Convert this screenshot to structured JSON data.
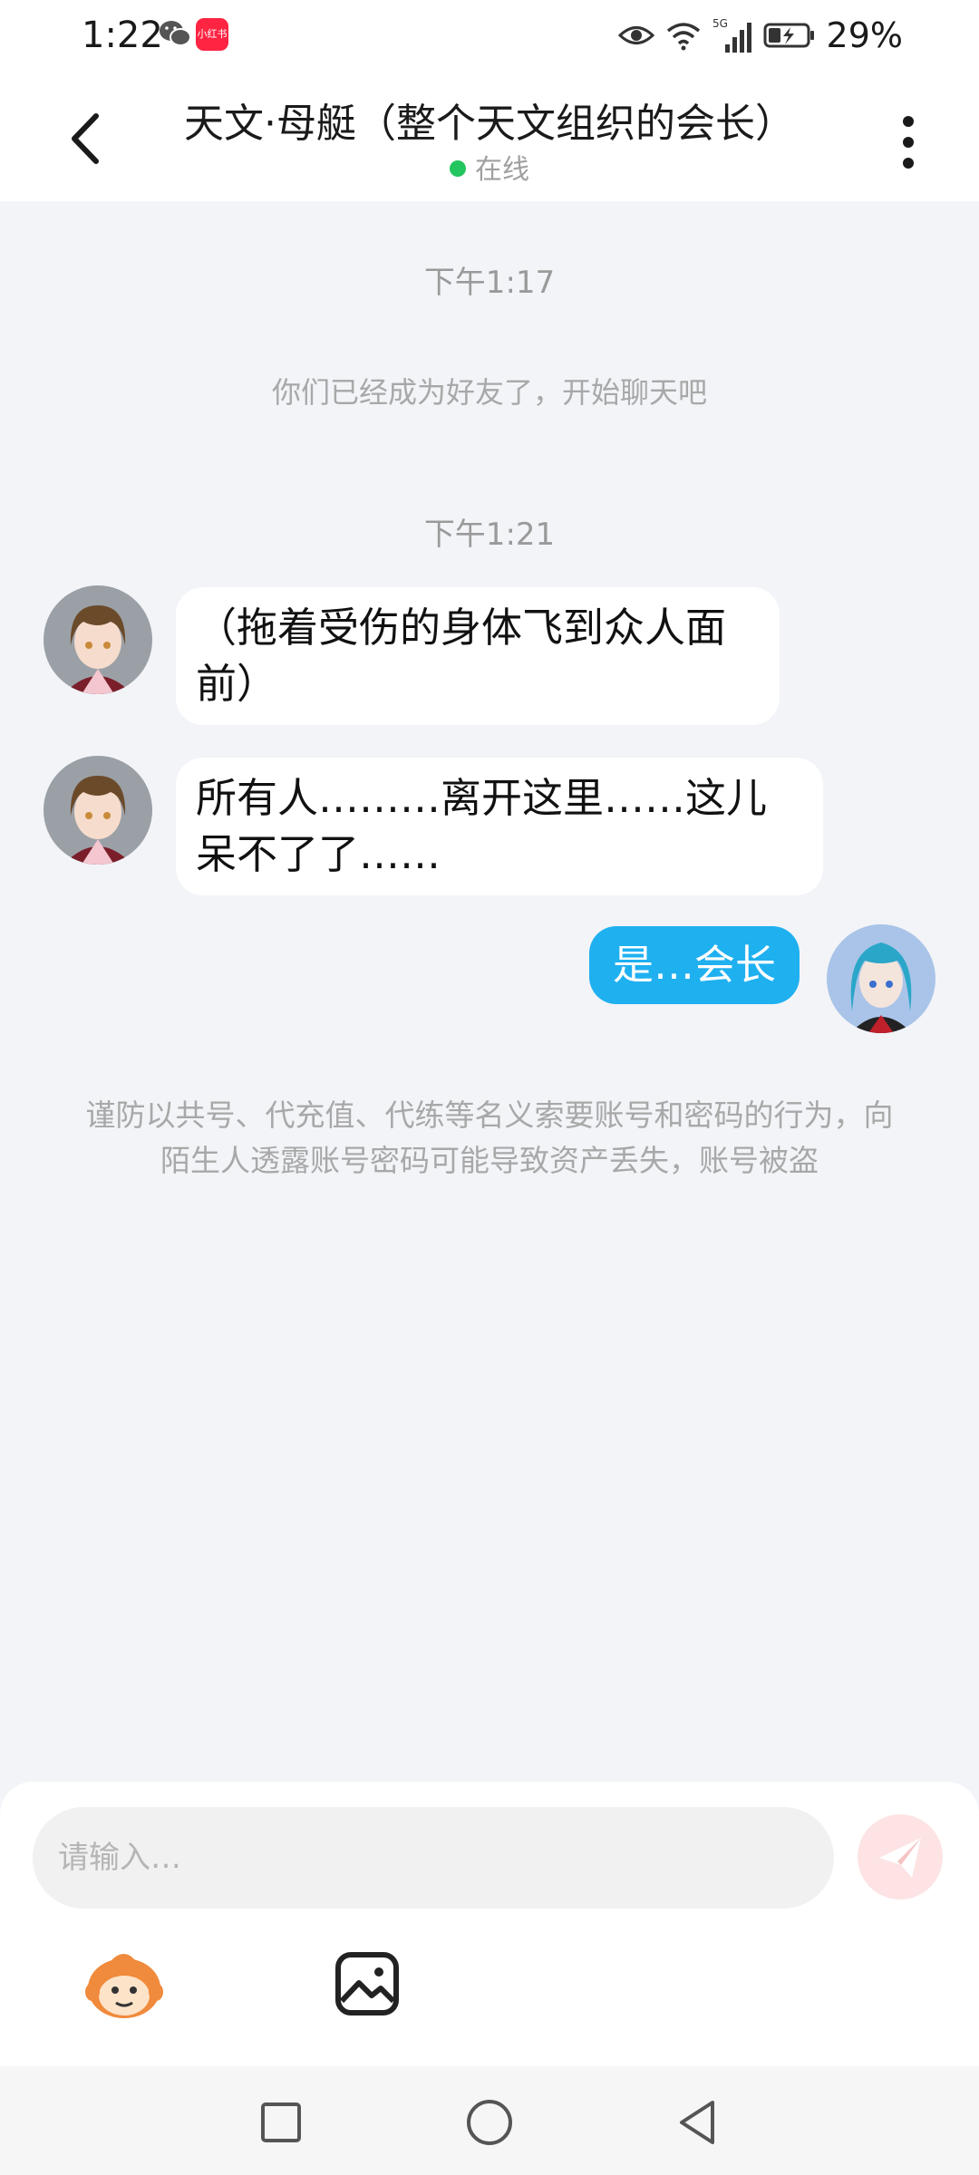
{
  "status_bar": {
    "time": "1:22",
    "xiaohongshu_text": "小红书",
    "network": "5G",
    "battery": "29%",
    "icons": [
      "wechat-icon",
      "xiaohongshu-icon",
      "eye-icon",
      "wifi-icon",
      "signal-icon",
      "battery-icon"
    ]
  },
  "header": {
    "title": "天文·母艇（整个天文组织的会长）",
    "status": "在线",
    "status_color": "#22c55e"
  },
  "chat": {
    "time_1": "下午1:17",
    "system_message": "你们已经成为好友了，开始聊天吧",
    "time_2": "下午1:21",
    "messages": [
      {
        "from": "other",
        "text": "（拖着受伤的身体飞到众人面前）"
      },
      {
        "from": "other",
        "text": "所有人………离开这里……这儿呆不了了……"
      },
      {
        "from": "self",
        "text": "是…会长"
      }
    ],
    "warning": "谨防以共号、代充值、代练等名义索要账号和密码的行为，向陌生人透露账号密码可能导致资产丢失，账号被盗"
  },
  "input": {
    "placeholder": "请输入…"
  },
  "toolbar": {
    "items": [
      "mascot-emoji-icon",
      "image-icon"
    ]
  },
  "colors": {
    "accent": "#1fb0f0",
    "background": "#f2f4f8",
    "send_button": "#fde3e3"
  }
}
